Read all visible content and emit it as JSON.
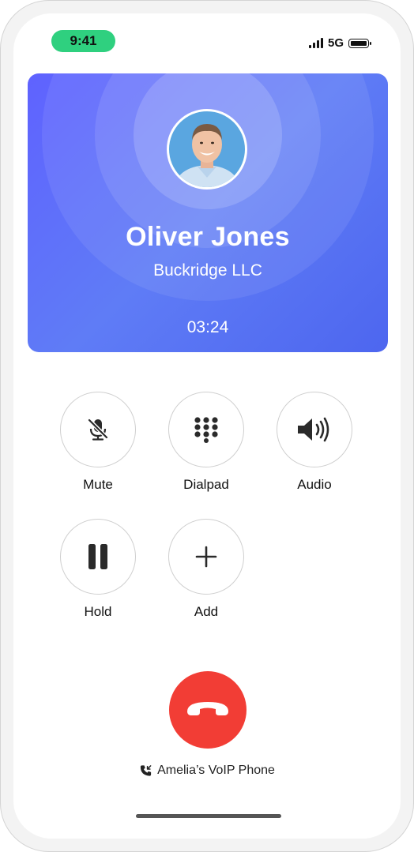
{
  "status_bar": {
    "time": "9:41",
    "network": "5G"
  },
  "caller": {
    "name": "Oliver Jones",
    "company": "Buckridge LLC",
    "duration": "03:24"
  },
  "controls": [
    {
      "label": "Mute",
      "icon": "mic-off-icon"
    },
    {
      "label": "Dialpad",
      "icon": "dialpad-icon"
    },
    {
      "label": "Audio",
      "icon": "speaker-icon"
    },
    {
      "label": "Hold",
      "icon": "pause-icon"
    },
    {
      "label": "Add",
      "icon": "plus-icon"
    }
  ],
  "end_call": {
    "icon": "hang-up-icon",
    "color": "#f23d35"
  },
  "line": {
    "label": "Amelia’s VoIP Phone",
    "icon": "incoming-call-icon"
  },
  "colors": {
    "accent": "#5f62ff",
    "status_pill": "#2fd07f",
    "end_call": "#f23d35"
  }
}
